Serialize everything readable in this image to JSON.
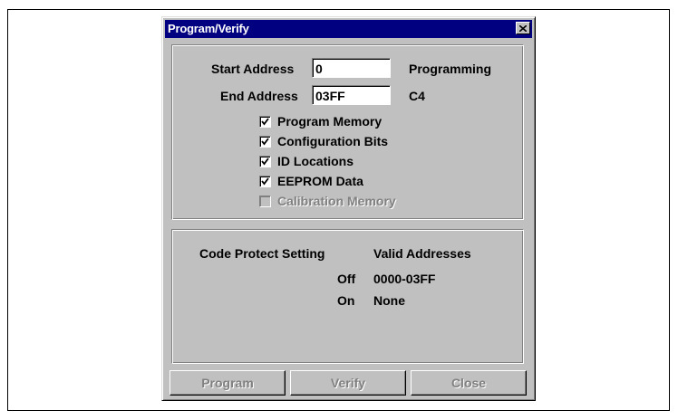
{
  "window": {
    "title": "Program/Verify",
    "close_label": "×"
  },
  "address": {
    "start_label": "Start Address",
    "start_value": "0",
    "end_label": "End Address",
    "end_value": "03FF",
    "status_text": "Programming",
    "device_text": "C4"
  },
  "options": [
    {
      "label": "Program Memory",
      "checked": true,
      "enabled": true
    },
    {
      "label": "Configuration Bits",
      "checked": true,
      "enabled": true
    },
    {
      "label": "ID Locations",
      "checked": true,
      "enabled": true
    },
    {
      "label": "EEPROM Data",
      "checked": true,
      "enabled": true
    },
    {
      "label": "Calibration Memory",
      "checked": false,
      "enabled": false
    }
  ],
  "code_protect": {
    "header_setting": "Code Protect Setting",
    "header_addresses": "Valid Addresses",
    "rows": [
      {
        "setting": "Off",
        "addresses": "0000-03FF"
      },
      {
        "setting": "On",
        "addresses": "None"
      }
    ]
  },
  "buttons": {
    "program": "Program",
    "verify": "Verify",
    "close": "Close"
  }
}
